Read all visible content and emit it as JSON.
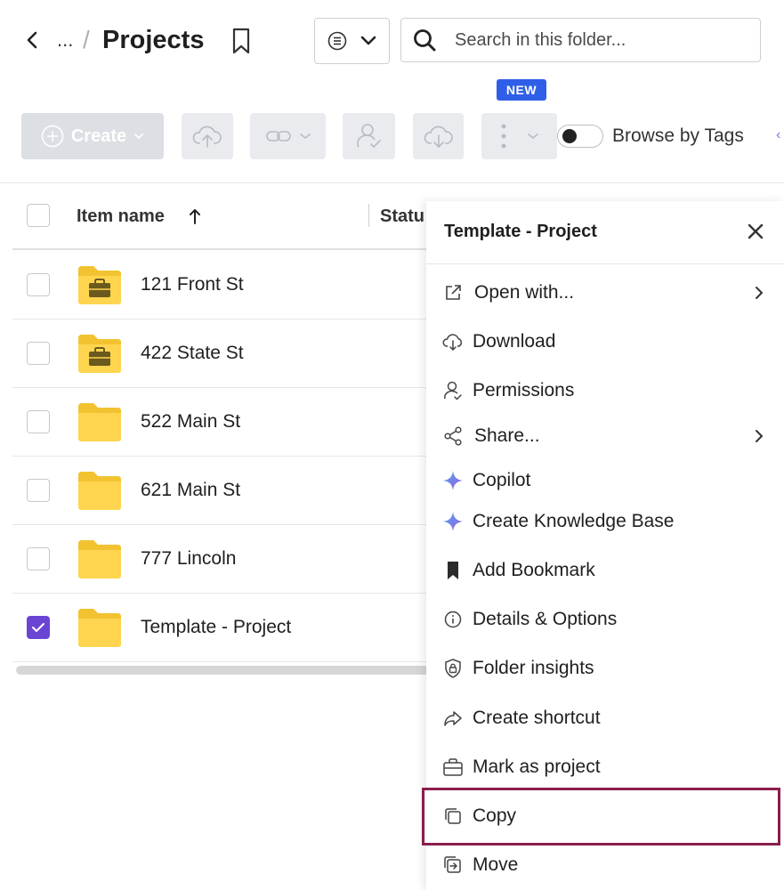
{
  "header": {
    "ellipsis": "...",
    "separator": "/",
    "title": "Projects",
    "search_placeholder": "Search in this folder..."
  },
  "new_badge": "NEW",
  "toolbar": {
    "create_label": "Create",
    "browse_by_tags_label": "Browse by Tags",
    "browse_by_tags_on": false
  },
  "table": {
    "column_name": "Item name",
    "column_status": "Statu",
    "rows": [
      {
        "name": "121 Front St",
        "type": "project-folder",
        "checked": false
      },
      {
        "name": "422 State St",
        "type": "project-folder",
        "checked": false
      },
      {
        "name": "522 Main St",
        "type": "folder",
        "checked": false
      },
      {
        "name": "621 Main St",
        "type": "folder",
        "checked": false
      },
      {
        "name": "777 Lincoln",
        "type": "folder",
        "checked": false
      },
      {
        "name": "Template - Project",
        "type": "folder",
        "checked": true
      }
    ]
  },
  "context_menu": {
    "title": "Template - Project",
    "items": [
      {
        "label": "Open with...",
        "icon": "external-link-icon",
        "submenu": true
      },
      {
        "label": "Download",
        "icon": "cloud-download-icon",
        "submenu": false
      },
      {
        "label": "Permissions",
        "icon": "user-check-icon",
        "submenu": false
      },
      {
        "label": "Share...",
        "icon": "share-icon",
        "submenu": true
      },
      {
        "label": "Copilot",
        "icon": "sparkle-icon",
        "submenu": false
      },
      {
        "label": "Create Knowledge Base",
        "icon": "sparkle-icon",
        "submenu": false
      },
      {
        "label": "Add Bookmark",
        "icon": "bookmark-filled-icon",
        "submenu": false
      },
      {
        "label": "Details & Options",
        "icon": "info-icon",
        "submenu": false
      },
      {
        "label": "Folder insights",
        "icon": "shield-icon",
        "submenu": false
      },
      {
        "label": "Create shortcut",
        "icon": "forward-arrow-icon",
        "submenu": false
      },
      {
        "label": "Mark as project",
        "icon": "briefcase-icon",
        "submenu": false
      },
      {
        "label": "Copy",
        "icon": "copy-icon",
        "submenu": false
      },
      {
        "label": "Move",
        "icon": "move-icon",
        "submenu": false
      }
    ],
    "highlighted_item": "Copy"
  },
  "colors": {
    "accent_purple": "#6a45d3",
    "new_badge_blue": "#2f5ee8",
    "folder_yellow": "#ffd54f",
    "highlight_border": "#8a1d4e"
  }
}
